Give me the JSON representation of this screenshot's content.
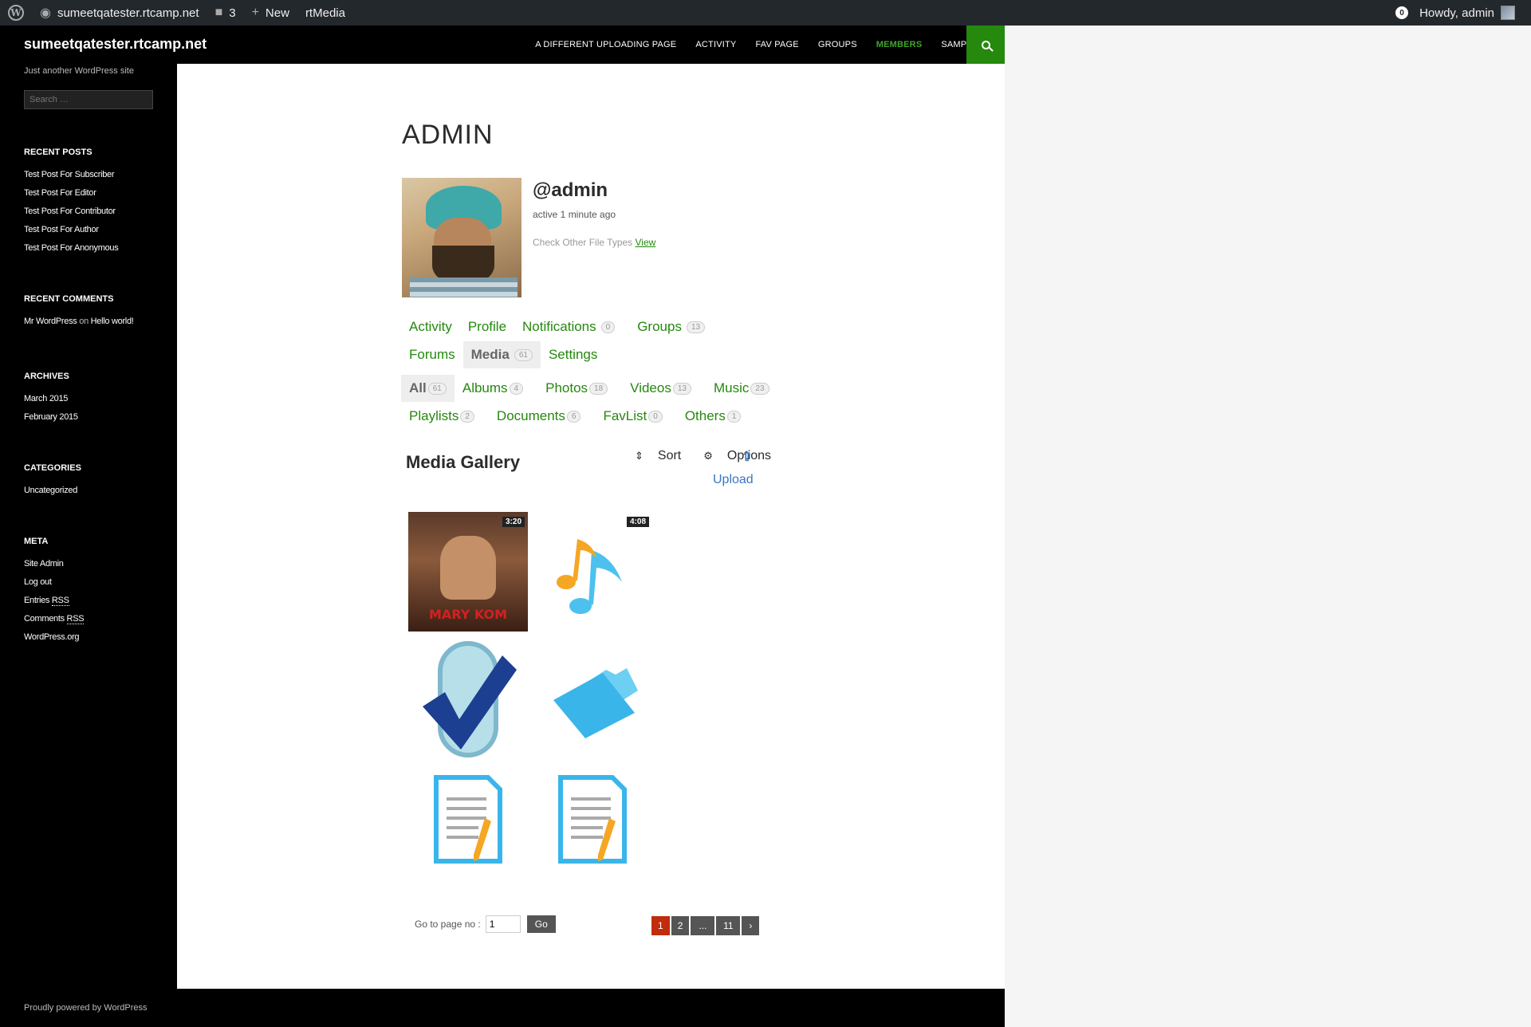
{
  "adminbar": {
    "site_name": "sumeetqatester.rtcamp.net",
    "comments_count": "3",
    "new_label": "New",
    "rtmedia_label": "rtMedia",
    "notif_count": "0",
    "howdy": "Howdy, admin"
  },
  "header": {
    "site_title": "sumeetqatester.rtcamp.net",
    "nav": [
      "A DIFFERENT UPLOADING PAGE",
      "ACTIVITY",
      "FAV PAGE",
      "GROUPS",
      "MEMBERS",
      "SAMPLE PAGE"
    ]
  },
  "sidebar": {
    "tagline": "Just another WordPress site",
    "search_placeholder": "Search …",
    "recent_posts_title": "RECENT POSTS",
    "recent_posts": [
      "Test Post For Subscriber",
      "Test Post For Editor",
      "Test Post For Contributor",
      "Test Post For Author",
      "Test Post For Anonymous"
    ],
    "recent_comments_title": "RECENT COMMENTS",
    "comment_author": "Mr WordPress",
    "comment_on": "on",
    "comment_post": "Hello world!",
    "archives_title": "ARCHIVES",
    "archives": [
      "March 2015",
      "February 2015"
    ],
    "categories_title": "CATEGORIES",
    "categories": [
      "Uncategorized"
    ],
    "meta_title": "META",
    "meta_site_admin": "Site Admin",
    "meta_logout": "Log out",
    "meta_entries": "Entries",
    "meta_comments": "Comments",
    "meta_rss": "RSS",
    "meta_wporg": "WordPress.org"
  },
  "profile": {
    "page_title": "ADMIN",
    "username": "@admin",
    "activity": "active 1 minute ago",
    "other_types": "Check Other File Types",
    "view_link": "View"
  },
  "profile_nav": {
    "activity": "Activity",
    "profile": "Profile",
    "notifications": "Notifications",
    "notifications_count": "0",
    "groups": "Groups",
    "groups_count": "13",
    "forums": "Forums",
    "media": "Media",
    "media_count": "61",
    "settings": "Settings"
  },
  "media_nav": {
    "all": "All",
    "all_count": "61",
    "albums": "Albums",
    "albums_count": "4",
    "photos": "Photos",
    "photos_count": "18",
    "videos": "Videos",
    "videos_count": "13",
    "music": "Music",
    "music_count": "23",
    "playlists": "Playlists",
    "playlists_count": "2",
    "documents": "Documents",
    "documents_count": "6",
    "favlist": "FavList",
    "favlist_count": "0",
    "others": "Others",
    "others_count": "1"
  },
  "gallery": {
    "title": "Media Gallery",
    "sort": "Sort",
    "options": "Options",
    "upload": "Upload",
    "video_duration": "3:20",
    "poster_text": "MARY KOM",
    "music_duration": "4:08"
  },
  "pagination": {
    "goto_label": "Go to page no :",
    "goto_value": "1",
    "go": "Go",
    "pages": [
      "1",
      "2",
      "...",
      "11",
      "›"
    ]
  },
  "footer": {
    "credit": "Proudly powered by WordPress"
  },
  "colors": {
    "accent": "#24890d",
    "current_page": "#c02c0c",
    "link_blue": "#3a75c4"
  }
}
